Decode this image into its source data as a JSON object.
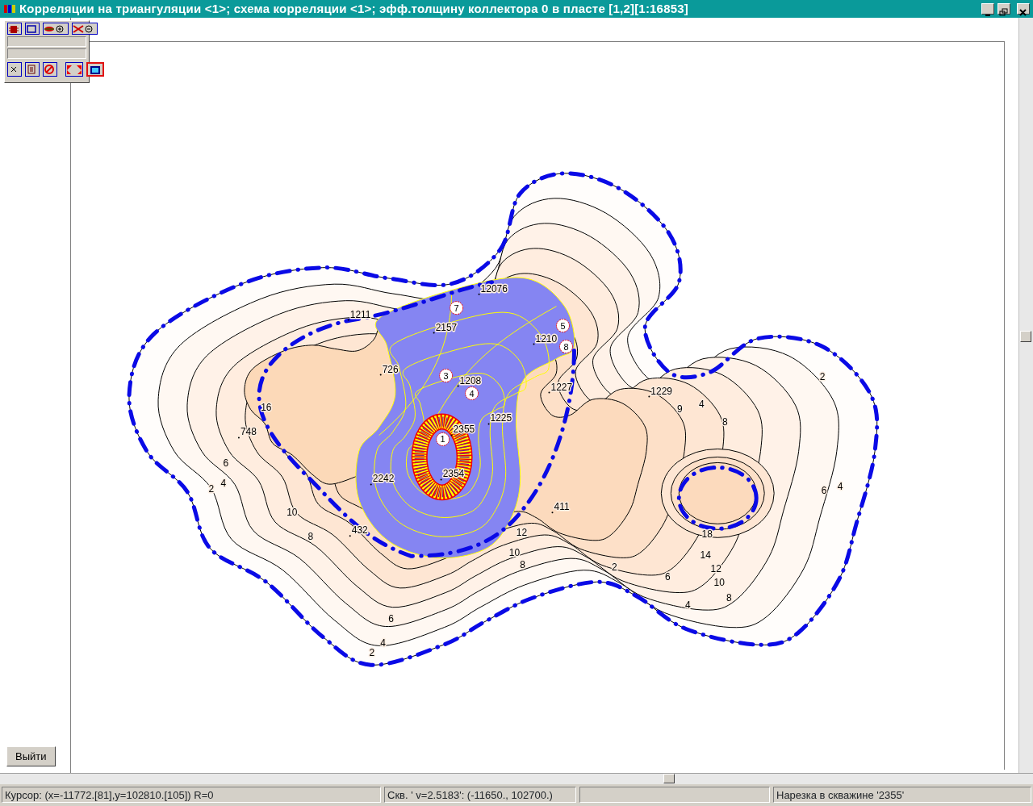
{
  "window": {
    "title": "Корреляции на триангуляции <1>; схема корреляции <1>; эфф.толщину коллектора 0 в пласте [1,2][1:16853]"
  },
  "toolbar": {
    "top_buttons": [
      {
        "selected": false
      },
      {
        "selected": false
      },
      {
        "selected": false
      },
      {
        "selected": false
      }
    ],
    "bottom_buttons": [
      {
        "selected": false
      },
      {
        "selected": false
      },
      {
        "selected": false
      },
      {
        "selected": false
      },
      {
        "selected": true
      }
    ]
  },
  "exit_button": {
    "label": "Выйти"
  },
  "map": {
    "wells": [
      {
        "label": "12076"
      },
      {
        "label": "2157"
      },
      {
        "label": "1211"
      },
      {
        "label": "726"
      },
      {
        "label": "1210"
      },
      {
        "label": "1208"
      },
      {
        "label": "1227"
      },
      {
        "label": "1229"
      },
      {
        "label": "1225"
      },
      {
        "label": "2355"
      },
      {
        "label": "2354"
      },
      {
        "label": "748"
      },
      {
        "label": "2242"
      },
      {
        "label": "432"
      },
      {
        "label": "411"
      }
    ],
    "well_markers": [
      {
        "label": "7"
      },
      {
        "label": "3"
      },
      {
        "label": "4"
      },
      {
        "label": "5"
      },
      {
        "label": "8"
      },
      {
        "label": "1"
      }
    ],
    "contour_labels": [
      "16",
      "10",
      "8",
      "12",
      "10",
      "8",
      "18",
      "14",
      "12",
      "10",
      "8",
      "6",
      "4",
      "2",
      "6",
      "4",
      "2",
      "6",
      "4",
      "2",
      "9",
      "4",
      "8",
      "6",
      "4",
      "2"
    ]
  },
  "status_bar": {
    "cursor": "Курсор: (x=-11772.[81],y=102810.[105]) R=0",
    "well_value": "Скв. ' v=2.5183': (-11650., 102700.)",
    "slice": "Нарезка в скважине '2355'"
  }
}
